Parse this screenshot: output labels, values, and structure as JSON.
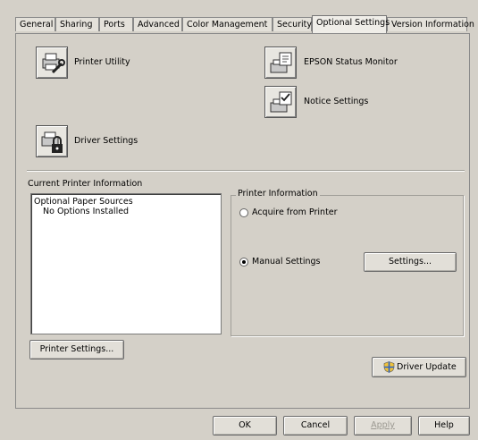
{
  "tabs": [
    {
      "label": "General"
    },
    {
      "label": "Sharing"
    },
    {
      "label": "Ports"
    },
    {
      "label": "Advanced"
    },
    {
      "label": "Color Management"
    },
    {
      "label": "Security"
    },
    {
      "label": "Optional Settings"
    },
    {
      "label": "Version Information"
    }
  ],
  "active_tab": "Optional Settings",
  "tools": {
    "printer_utility": "Printer Utility",
    "status_monitor": "EPSON Status Monitor",
    "notice_settings": "Notice Settings",
    "driver_settings": "Driver Settings"
  },
  "current_info": {
    "heading": "Current Printer Information",
    "list": [
      "Optional Paper Sources",
      "No Options Installed"
    ]
  },
  "printer_info": {
    "title": "Printer Information",
    "acquire_label": "Acquire from Printer",
    "manual_label": "Manual Settings",
    "selected": "Manual Settings",
    "settings_button": "Settings..."
  },
  "printer_settings_button": "Printer Settings...",
  "driver_update_button": "Driver Update",
  "footer": {
    "ok": "OK",
    "cancel": "Cancel",
    "apply": "Apply",
    "help": "Help"
  }
}
